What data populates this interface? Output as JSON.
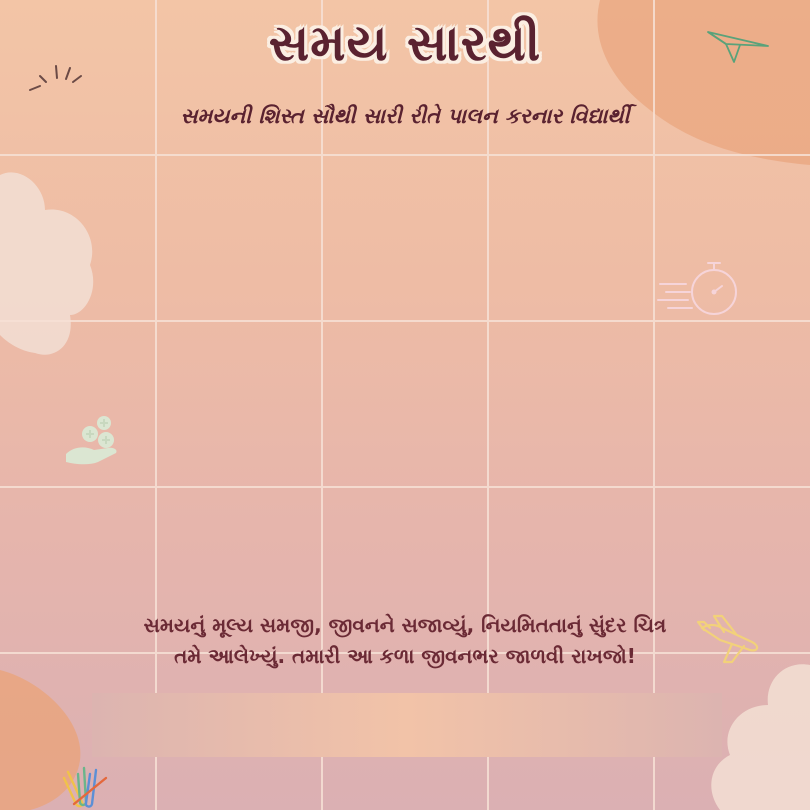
{
  "header": {
    "title": "સમય સારથી",
    "subtitle": "સમયની શિસ્ત સૌથી સારી રીતે પાલન કરનાર વિદ્યાર્થી"
  },
  "message": {
    "line1": "સમયનું મૂલ્ય સમજી, જીવનને સજાવ્યું, નિયમિતતાનું સુંદર ચિત્ર",
    "line2": "તમે આલેખ્યું. તમારી આ કળા જીવનભર જાળવી રાખજો!"
  },
  "colors": {
    "text_dark": "#5a2230",
    "accent_peach": "#e9a57f",
    "cloud": "#f2ddd2"
  },
  "icons": [
    "sun-rays-icon",
    "paper-plane-icon",
    "stopwatch-icon",
    "hand-coins-icon",
    "airplane-icon",
    "paper-clips-icon"
  ]
}
